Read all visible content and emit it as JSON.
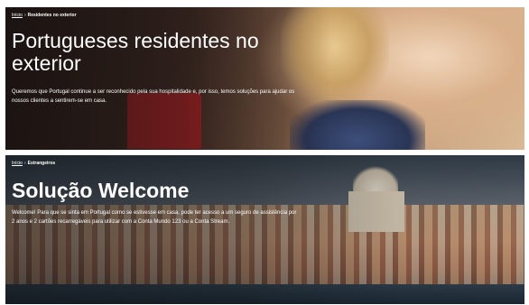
{
  "banners": [
    {
      "breadcrumb": {
        "home": "Início",
        "separator": "›",
        "current": "Residentes no exterior"
      },
      "title": "Portugueses residentes no exterior",
      "description": "Queremos que Portugal continue a ser reconhecido pela sua hospitalidade e, por isso, temos soluções para ajudar os nossos clientes a sentirem-se em casa."
    },
    {
      "breadcrumb": {
        "home": "Início",
        "separator": "›",
        "current": "Estrangeiros"
      },
      "title": "Solução Welcome",
      "description": "Welcome! Para que se sinta em Portugal como se estivesse em casa, pode ter acesso a um seguro de assistência por 2 anos e 2 cartões recarregáveis para utilizar com a Conta Mundo 123 ou a Conta Stream."
    }
  ]
}
